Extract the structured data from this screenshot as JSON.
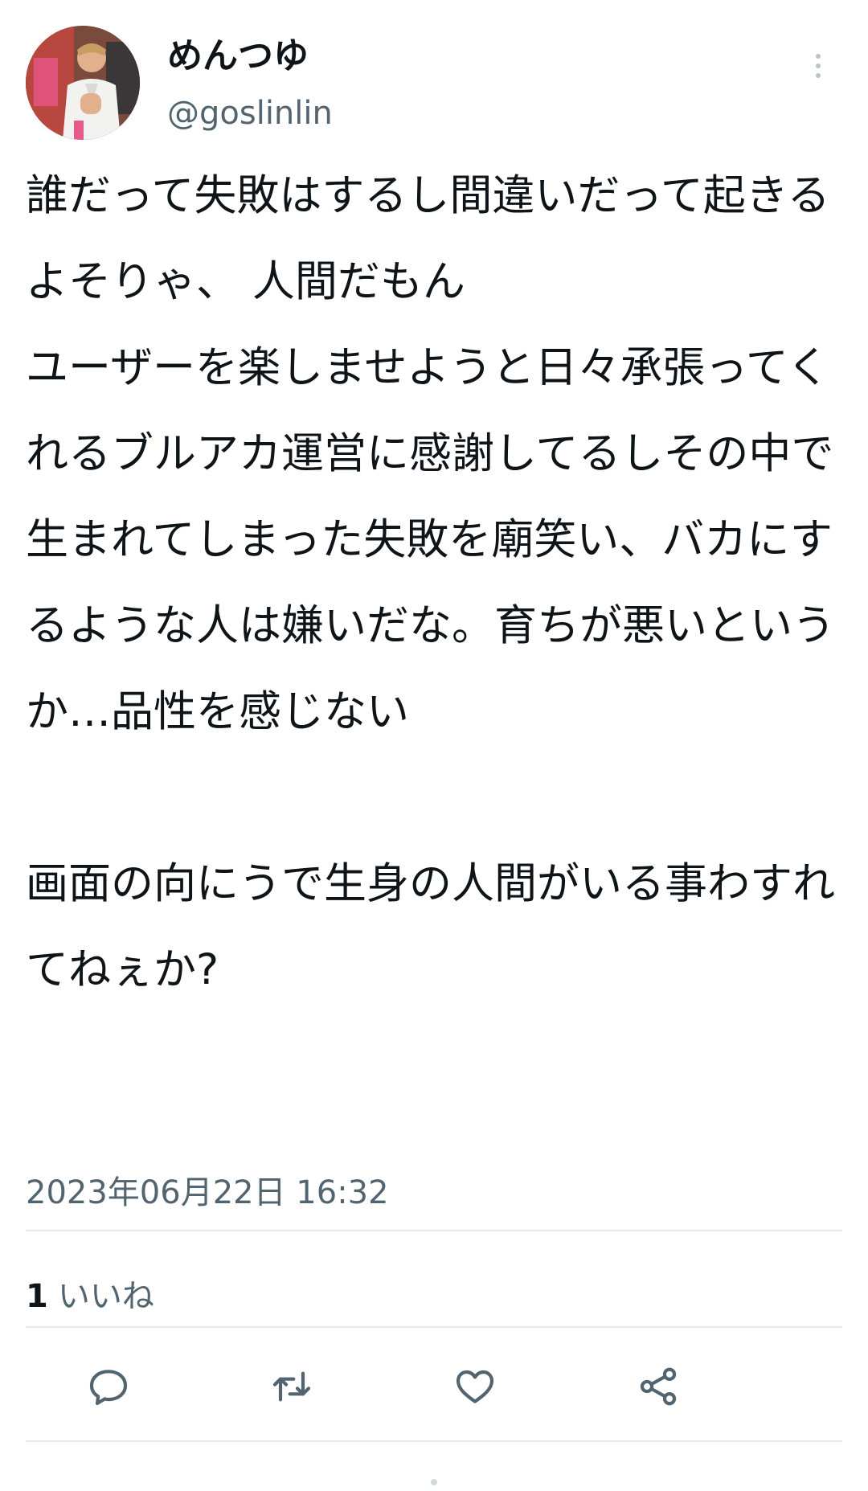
{
  "user": {
    "display_name": "めんつゆ",
    "handle": "@goslinlin",
    "avatar_icon": "profile-photo"
  },
  "tweet": {
    "text": "誰だって失敗はするし間違いだって起きるよそりゃ、 人間だもん\nユーザーを楽しませようと日々承張ってくれるブルアカ運営に感謝してるしその中で生まれてしまった失敗を廟笑い、バカにするような人は嫌いだな。育ちが悪いというか…品性を感じない\n\n画面の向にうで生身の人間がいる事わすれてねぇか?",
    "timestamp": "2023年06月22日 16:32"
  },
  "stats": {
    "likes_count": "1",
    "likes_label": "いいね"
  },
  "actions": {
    "reply_icon": "reply-icon",
    "retweet_icon": "retweet-icon",
    "like_icon": "heart-icon",
    "share_icon": "share-icon"
  },
  "colors": {
    "text_primary": "#0f1419",
    "text_secondary": "#536471",
    "divider": "#e6e9eb"
  }
}
